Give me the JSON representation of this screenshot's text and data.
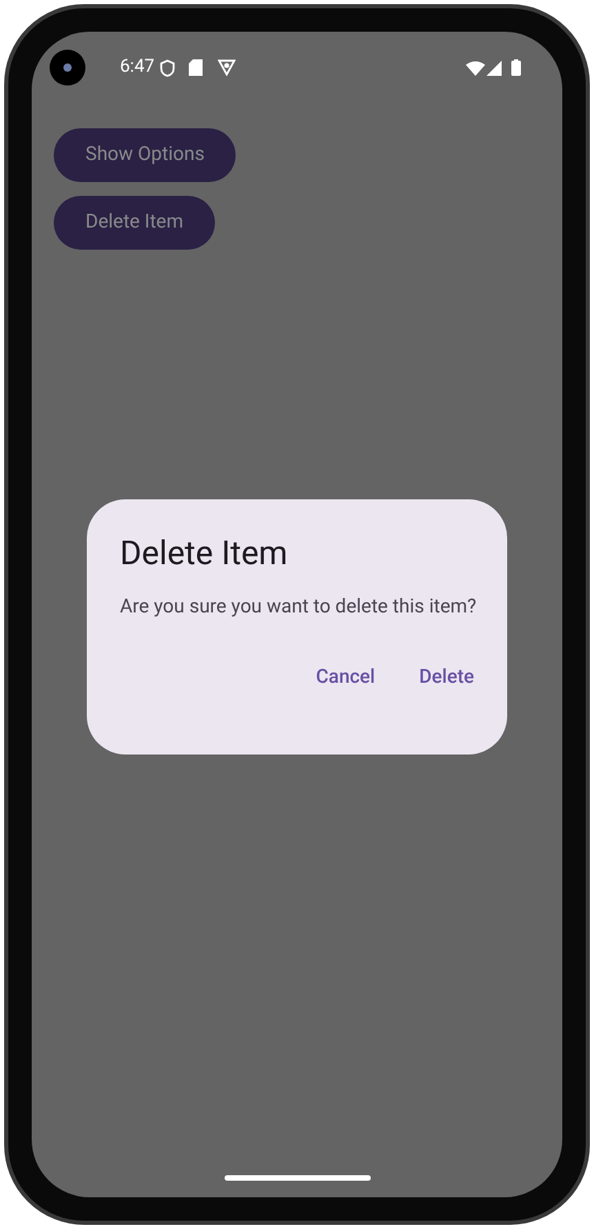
{
  "status_bar": {
    "time": "6:47"
  },
  "buttons": [
    {
      "label": "Show Options"
    },
    {
      "label": "Delete Item"
    }
  ],
  "dialog": {
    "title": "Delete Item",
    "message": "Are you sure you want to delete this item?",
    "actions": [
      {
        "label": "Cancel"
      },
      {
        "label": "Delete"
      }
    ]
  }
}
